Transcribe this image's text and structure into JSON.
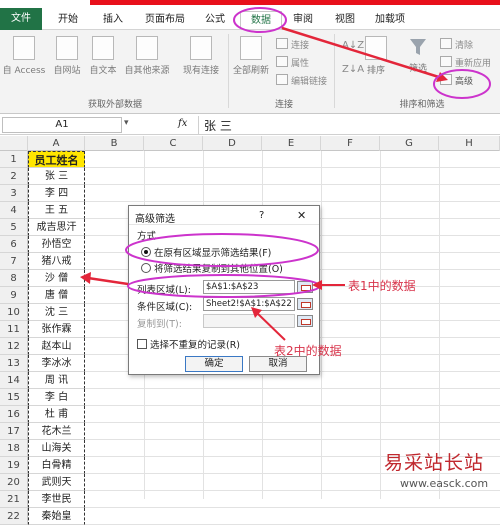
{
  "ribbon_tabs": [
    "文件",
    "开始",
    "插入",
    "页面布局",
    "公式",
    "数据",
    "审阅",
    "视图",
    "加载项"
  ],
  "ribbon": {
    "external_buttons": [
      "自 Access",
      "自网站",
      "自文本",
      "自其他来源",
      "现有连接"
    ],
    "external_group": "获取外部数据",
    "refresh_all": "全部刷新",
    "conn_small": [
      "连接",
      "属性",
      "编辑链接"
    ],
    "conn_group": "连接",
    "sort_label": "排序",
    "filter_label": "筛选",
    "clear_label": "清除",
    "reapply_label": "重新应用",
    "advanced_label": "高级",
    "sort_group": "排序和筛选"
  },
  "formula_bar": {
    "name_box": "A1",
    "fx": "fx",
    "value": "张  三"
  },
  "columns": [
    "A",
    "B",
    "C",
    "D",
    "E",
    "F",
    "G",
    "H"
  ],
  "rows": [
    {
      "n": "1",
      "v": "员工姓名"
    },
    {
      "n": "2",
      "v": "张  三"
    },
    {
      "n": "3",
      "v": "李  四"
    },
    {
      "n": "4",
      "v": "王  五"
    },
    {
      "n": "5",
      "v": "成吉思汗"
    },
    {
      "n": "6",
      "v": "孙悟空"
    },
    {
      "n": "7",
      "v": "猪八戒"
    },
    {
      "n": "8",
      "v": "沙  僧"
    },
    {
      "n": "9",
      "v": "唐  僧"
    },
    {
      "n": "10",
      "v": "沈  三"
    },
    {
      "n": "11",
      "v": "张作霖"
    },
    {
      "n": "12",
      "v": "赵本山"
    },
    {
      "n": "13",
      "v": "李冰冰"
    },
    {
      "n": "14",
      "v": "周  讯"
    },
    {
      "n": "15",
      "v": "李  白"
    },
    {
      "n": "16",
      "v": "杜  甫"
    },
    {
      "n": "17",
      "v": "花木兰"
    },
    {
      "n": "18",
      "v": "山海关"
    },
    {
      "n": "19",
      "v": "白骨精"
    },
    {
      "n": "20",
      "v": "武则天"
    },
    {
      "n": "21",
      "v": "李世民"
    },
    {
      "n": "22",
      "v": "秦始皇"
    }
  ],
  "dialog": {
    "title": "高级筛选",
    "help": "?",
    "close": "✕",
    "method_label": "方式",
    "opt1": "在原有区域显示筛选结果(F)",
    "opt2": "将筛选结果复制到其他位置(O)",
    "list_label": "列表区域(L):",
    "list_value": "$A$1:$A$23",
    "criteria_label": "条件区域(C):",
    "criteria_value": "Sheet2!$A$1:$A$22",
    "copyto_label": "复制到(T):",
    "copyto_value": "",
    "unique_label": "选择不重复的记录(R)",
    "ok": "确定",
    "cancel": "取消"
  },
  "annotations": {
    "sheet1": "表1中的数据",
    "sheet2": "表2中的数据"
  },
  "watermark": {
    "brand": "易采站长站",
    "url": "www.easck.com"
  },
  "colors": {
    "excel_green": "#217346",
    "highlight": "#cc33cc",
    "annotation_red": "#d8334a",
    "header_yellow": "#ffe600"
  }
}
